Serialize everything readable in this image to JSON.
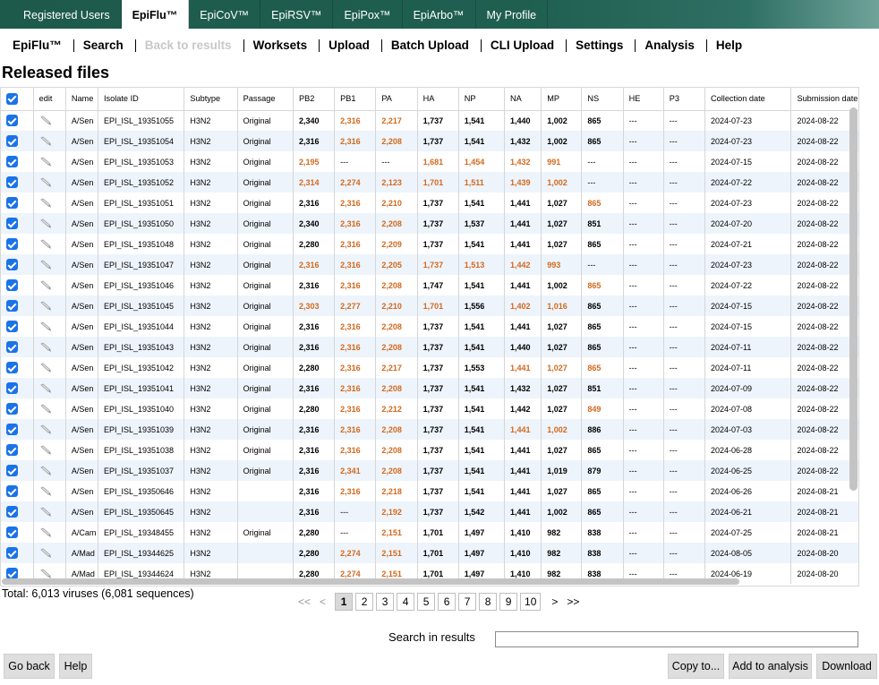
{
  "top_tabs": [
    "Registered Users",
    "EpiFlu™",
    "EpiCoV™",
    "EpiRSV™",
    "EpiPox™",
    "EpiArbo™",
    "My Profile"
  ],
  "active_top_tab": 1,
  "subnav": [
    "EpiFlu™",
    "Search",
    "Back to results",
    "Worksets",
    "Upload",
    "Batch Upload",
    "CLI Upload",
    "Settings",
    "Analysis",
    "Help"
  ],
  "page_title": "Released files",
  "columns": [
    "edit",
    "Name",
    "Isolate ID",
    "Subtype",
    "Passage",
    "PB2",
    "PB1",
    "PA",
    "HA",
    "NP",
    "NA",
    "MP",
    "NS",
    "HE",
    "P3",
    "Collection date",
    "Submission date"
  ],
  "rows": [
    {
      "name": "A/Sen",
      "id": "EPI_ISL_19351055",
      "subtype": "H3N2",
      "passage": "Original",
      "pb2": "2,340",
      "pb1": "2,316",
      "pa": "2,217",
      "ha": "1,737",
      "np": "1,541",
      "na": "1,440",
      "mp": "1,002",
      "ns": "865",
      "he": "---",
      "p3": "---",
      "cdate": "2024-07-23",
      "sdate": "2024-08-22",
      "orange": [
        "pb1",
        "pa"
      ]
    },
    {
      "name": "A/Sen",
      "id": "EPI_ISL_19351054",
      "subtype": "H3N2",
      "passage": "Original",
      "pb2": "2,316",
      "pb1": "2,316",
      "pa": "2,208",
      "ha": "1,737",
      "np": "1,541",
      "na": "1,432",
      "mp": "1,002",
      "ns": "865",
      "he": "---",
      "p3": "---",
      "cdate": "2024-07-23",
      "sdate": "2024-08-22",
      "orange": [
        "pb1",
        "pa"
      ]
    },
    {
      "name": "A/Sen",
      "id": "EPI_ISL_19351053",
      "subtype": "H3N2",
      "passage": "Original",
      "pb2": "2,195",
      "pb1": "---",
      "pa": "---",
      "ha": "1,681",
      "np": "1,454",
      "na": "1,432",
      "mp": "991",
      "ns": "---",
      "he": "---",
      "p3": "---",
      "cdate": "2024-07-15",
      "sdate": "2024-08-22",
      "orange": [
        "pb2",
        "ha",
        "np",
        "na",
        "mp"
      ]
    },
    {
      "name": "A/Sen",
      "id": "EPI_ISL_19351052",
      "subtype": "H3N2",
      "passage": "Original",
      "pb2": "2,314",
      "pb1": "2,274",
      "pa": "2,123",
      "ha": "1,701",
      "np": "1,511",
      "na": "1,439",
      "mp": "1,002",
      "ns": "---",
      "he": "---",
      "p3": "---",
      "cdate": "2024-07-22",
      "sdate": "2024-08-22",
      "orange": [
        "pb2",
        "pb1",
        "pa",
        "ha",
        "np",
        "na",
        "mp"
      ]
    },
    {
      "name": "A/Sen",
      "id": "EPI_ISL_19351051",
      "subtype": "H3N2",
      "passage": "Original",
      "pb2": "2,316",
      "pb1": "2,316",
      "pa": "2,210",
      "ha": "1,737",
      "np": "1,541",
      "na": "1,441",
      "mp": "1,027",
      "ns": "865",
      "he": "---",
      "p3": "---",
      "cdate": "2024-07-23",
      "sdate": "2024-08-22",
      "orange": [
        "pb1",
        "pa",
        "ns"
      ]
    },
    {
      "name": "A/Sen",
      "id": "EPI_ISL_19351050",
      "subtype": "H3N2",
      "passage": "Original",
      "pb2": "2,340",
      "pb1": "2,316",
      "pa": "2,208",
      "ha": "1,737",
      "np": "1,537",
      "na": "1,441",
      "mp": "1,027",
      "ns": "851",
      "he": "---",
      "p3": "---",
      "cdate": "2024-07-20",
      "sdate": "2024-08-22",
      "orange": [
        "pb1",
        "pa"
      ]
    },
    {
      "name": "A/Sen",
      "id": "EPI_ISL_19351048",
      "subtype": "H3N2",
      "passage": "Original",
      "pb2": "2,280",
      "pb1": "2,316",
      "pa": "2,209",
      "ha": "1,737",
      "np": "1,541",
      "na": "1,441",
      "mp": "1,027",
      "ns": "865",
      "he": "---",
      "p3": "---",
      "cdate": "2024-07-21",
      "sdate": "2024-08-22",
      "orange": [
        "pb1",
        "pa"
      ]
    },
    {
      "name": "A/Sen",
      "id": "EPI_ISL_19351047",
      "subtype": "H3N2",
      "passage": "Original",
      "pb2": "2,316",
      "pb1": "2,316",
      "pa": "2,205",
      "ha": "1,737",
      "np": "1,513",
      "na": "1,442",
      "mp": "993",
      "ns": "---",
      "he": "---",
      "p3": "---",
      "cdate": "2024-07-23",
      "sdate": "2024-08-22",
      "orange": [
        "pb2",
        "pb1",
        "pa",
        "ha",
        "np",
        "na",
        "mp"
      ]
    },
    {
      "name": "A/Sen",
      "id": "EPI_ISL_19351046",
      "subtype": "H3N2",
      "passage": "Original",
      "pb2": "2,316",
      "pb1": "2,316",
      "pa": "2,208",
      "ha": "1,747",
      "np": "1,541",
      "na": "1,441",
      "mp": "1,002",
      "ns": "865",
      "he": "---",
      "p3": "---",
      "cdate": "2024-07-22",
      "sdate": "2024-08-22",
      "orange": [
        "pb1",
        "pa",
        "ns"
      ]
    },
    {
      "name": "A/Sen",
      "id": "EPI_ISL_19351045",
      "subtype": "H3N2",
      "passage": "Original",
      "pb2": "2,303",
      "pb1": "2,277",
      "pa": "2,210",
      "ha": "1,701",
      "np": "1,556",
      "na": "1,402",
      "mp": "1,016",
      "ns": "865",
      "he": "---",
      "p3": "---",
      "cdate": "2024-07-15",
      "sdate": "2024-08-22",
      "orange": [
        "pb2",
        "pb1",
        "pa",
        "ha",
        "na",
        "mp"
      ]
    },
    {
      "name": "A/Sen",
      "id": "EPI_ISL_19351044",
      "subtype": "H3N2",
      "passage": "Original",
      "pb2": "2,316",
      "pb1": "2,316",
      "pa": "2,208",
      "ha": "1,737",
      "np": "1,541",
      "na": "1,441",
      "mp": "1,027",
      "ns": "865",
      "he": "---",
      "p3": "---",
      "cdate": "2024-07-15",
      "sdate": "2024-08-22",
      "orange": [
        "pb1",
        "pa"
      ]
    },
    {
      "name": "A/Sen",
      "id": "EPI_ISL_19351043",
      "subtype": "H3N2",
      "passage": "Original",
      "pb2": "2,316",
      "pb1": "2,316",
      "pa": "2,208",
      "ha": "1,737",
      "np": "1,541",
      "na": "1,440",
      "mp": "1,027",
      "ns": "865",
      "he": "---",
      "p3": "---",
      "cdate": "2024-07-11",
      "sdate": "2024-08-22",
      "orange": [
        "pb1",
        "pa"
      ]
    },
    {
      "name": "A/Sen",
      "id": "EPI_ISL_19351042",
      "subtype": "H3N2",
      "passage": "Original",
      "pb2": "2,280",
      "pb1": "2,316",
      "pa": "2,217",
      "ha": "1,737",
      "np": "1,553",
      "na": "1,441",
      "mp": "1,027",
      "ns": "865",
      "he": "---",
      "p3": "---",
      "cdate": "2024-07-11",
      "sdate": "2024-08-22",
      "orange": [
        "pb1",
        "pa",
        "na",
        "mp",
        "ns"
      ]
    },
    {
      "name": "A/Sen",
      "id": "EPI_ISL_19351041",
      "subtype": "H3N2",
      "passage": "Original",
      "pb2": "2,316",
      "pb1": "2,316",
      "pa": "2,208",
      "ha": "1,737",
      "np": "1,541",
      "na": "1,432",
      "mp": "1,027",
      "ns": "851",
      "he": "---",
      "p3": "---",
      "cdate": "2024-07-09",
      "sdate": "2024-08-22",
      "orange": [
        "pb1",
        "pa"
      ]
    },
    {
      "name": "A/Sen",
      "id": "EPI_ISL_19351040",
      "subtype": "H3N2",
      "passage": "Original",
      "pb2": "2,280",
      "pb1": "2,316",
      "pa": "2,212",
      "ha": "1,737",
      "np": "1,541",
      "na": "1,442",
      "mp": "1,027",
      "ns": "849",
      "he": "---",
      "p3": "---",
      "cdate": "2024-07-08",
      "sdate": "2024-08-22",
      "orange": [
        "pb1",
        "pa",
        "ns"
      ]
    },
    {
      "name": "A/Sen",
      "id": "EPI_ISL_19351039",
      "subtype": "H3N2",
      "passage": "Original",
      "pb2": "2,316",
      "pb1": "2,316",
      "pa": "2,208",
      "ha": "1,737",
      "np": "1,541",
      "na": "1,441",
      "mp": "1,002",
      "ns": "886",
      "he": "---",
      "p3": "---",
      "cdate": "2024-07-03",
      "sdate": "2024-08-22",
      "orange": [
        "pb1",
        "pa",
        "na",
        "mp"
      ]
    },
    {
      "name": "A/Sen",
      "id": "EPI_ISL_19351038",
      "subtype": "H3N2",
      "passage": "Original",
      "pb2": "2,316",
      "pb1": "2,316",
      "pa": "2,208",
      "ha": "1,737",
      "np": "1,541",
      "na": "1,441",
      "mp": "1,027",
      "ns": "865",
      "he": "---",
      "p3": "---",
      "cdate": "2024-06-28",
      "sdate": "2024-08-22",
      "orange": [
        "pb1",
        "pa"
      ]
    },
    {
      "name": "A/Sen",
      "id": "EPI_ISL_19351037",
      "subtype": "H3N2",
      "passage": "Original",
      "pb2": "2,316",
      "pb1": "2,341",
      "pa": "2,208",
      "ha": "1,737",
      "np": "1,541",
      "na": "1,441",
      "mp": "1,019",
      "ns": "879",
      "he": "---",
      "p3": "---",
      "cdate": "2024-06-25",
      "sdate": "2024-08-22",
      "orange": [
        "pb1",
        "pa"
      ]
    },
    {
      "name": "A/Sen",
      "id": "EPI_ISL_19350646",
      "subtype": "H3N2",
      "passage": "",
      "pb2": "2,316",
      "pb1": "2,316",
      "pa": "2,218",
      "ha": "1,737",
      "np": "1,541",
      "na": "1,441",
      "mp": "1,027",
      "ns": "865",
      "he": "---",
      "p3": "---",
      "cdate": "2024-06-26",
      "sdate": "2024-08-21",
      "orange": [
        "pb1",
        "pa"
      ]
    },
    {
      "name": "A/Sen",
      "id": "EPI_ISL_19350645",
      "subtype": "H3N2",
      "passage": "",
      "pb2": "2,316",
      "pb1": "---",
      "pa": "2,192",
      "ha": "1,737",
      "np": "1,542",
      "na": "1,441",
      "mp": "1,002",
      "ns": "865",
      "he": "---",
      "p3": "---",
      "cdate": "2024-06-21",
      "sdate": "2024-08-21",
      "orange": [
        "pa"
      ]
    },
    {
      "name": "A/Cam",
      "id": "EPI_ISL_19348455",
      "subtype": "H3N2",
      "passage": "Original",
      "pb2": "2,280",
      "pb1": "---",
      "pa": "2,151",
      "ha": "1,701",
      "np": "1,497",
      "na": "1,410",
      "mp": "982",
      "ns": "838",
      "he": "---",
      "p3": "---",
      "cdate": "2024-07-25",
      "sdate": "2024-08-21",
      "orange": [
        "pa"
      ]
    },
    {
      "name": "A/Mad",
      "id": "EPI_ISL_19344625",
      "subtype": "H3N2",
      "passage": "",
      "pb2": "2,280",
      "pb1": "2,274",
      "pa": "2,151",
      "ha": "1,701",
      "np": "1,497",
      "na": "1,410",
      "mp": "982",
      "ns": "838",
      "he": "---",
      "p3": "---",
      "cdate": "2024-08-05",
      "sdate": "2024-08-20",
      "orange": [
        "pb1",
        "pa"
      ]
    },
    {
      "name": "A/Mad",
      "id": "EPI_ISL_19344624",
      "subtype": "H3N2",
      "passage": "",
      "pb2": "2,280",
      "pb1": "2,274",
      "pa": "2,151",
      "ha": "1,701",
      "np": "1,497",
      "na": "1,410",
      "mp": "982",
      "ns": "838",
      "he": "---",
      "p3": "---",
      "cdate": "2024-06-19",
      "sdate": "2024-08-20",
      "orange": [
        "pb1",
        "pa"
      ]
    }
  ],
  "total_text": "Total: 6,013 viruses (6,081 sequences)",
  "pager": {
    "first": "<<",
    "prev": "<",
    "pages": [
      "1",
      "2",
      "3",
      "4",
      "5",
      "6",
      "7",
      "8",
      "9",
      "10"
    ],
    "current": "1",
    "next": ">",
    "last": ">>"
  },
  "search_label": "Search in results",
  "search_value": "",
  "buttons": {
    "go_back": "Go back",
    "help": "Help",
    "copy_to": "Copy to...",
    "add_to_analysis": "Add to analysis",
    "download": "Download"
  },
  "colors": {
    "header_green": "#1f5f50",
    "orange_value": "#d2691e",
    "checkbox_blue": "#1a73e8",
    "zebra_row": "#eef4fb"
  }
}
